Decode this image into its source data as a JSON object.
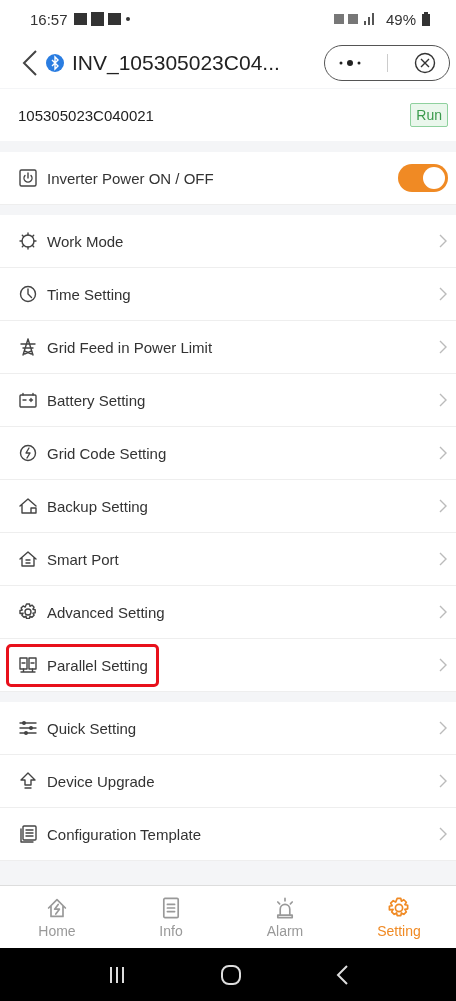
{
  "status_bar": {
    "time": "16:57",
    "battery": "49%"
  },
  "header": {
    "title": "INV_105305023C04..."
  },
  "device": {
    "serial": "105305023C040021",
    "status": "Run"
  },
  "power": {
    "label": "Inverter Power ON / OFF",
    "on": true
  },
  "settings_groups": [
    {
      "items": [
        {
          "label": "Work Mode",
          "highlighted": false
        },
        {
          "label": "Time Setting",
          "highlighted": false
        },
        {
          "label": "Grid Feed in Power Limit",
          "highlighted": false
        },
        {
          "label": "Battery Setting",
          "highlighted": false
        },
        {
          "label": "Grid Code Setting",
          "highlighted": false
        },
        {
          "label": "Backup Setting",
          "highlighted": false
        },
        {
          "label": "Smart Port",
          "highlighted": false
        },
        {
          "label": "Advanced Setting",
          "highlighted": false
        },
        {
          "label": "Parallel Setting",
          "highlighted": true
        }
      ]
    },
    {
      "items": [
        {
          "label": "Quick Setting",
          "highlighted": false
        },
        {
          "label": "Device Upgrade",
          "highlighted": false
        },
        {
          "label": "Configuration Template",
          "highlighted": false
        }
      ]
    }
  ],
  "tabs": [
    {
      "label": "Home",
      "selected": false
    },
    {
      "label": "Info",
      "selected": false
    },
    {
      "label": "Alarm",
      "selected": false
    },
    {
      "label": "Setting",
      "selected": true
    }
  ]
}
